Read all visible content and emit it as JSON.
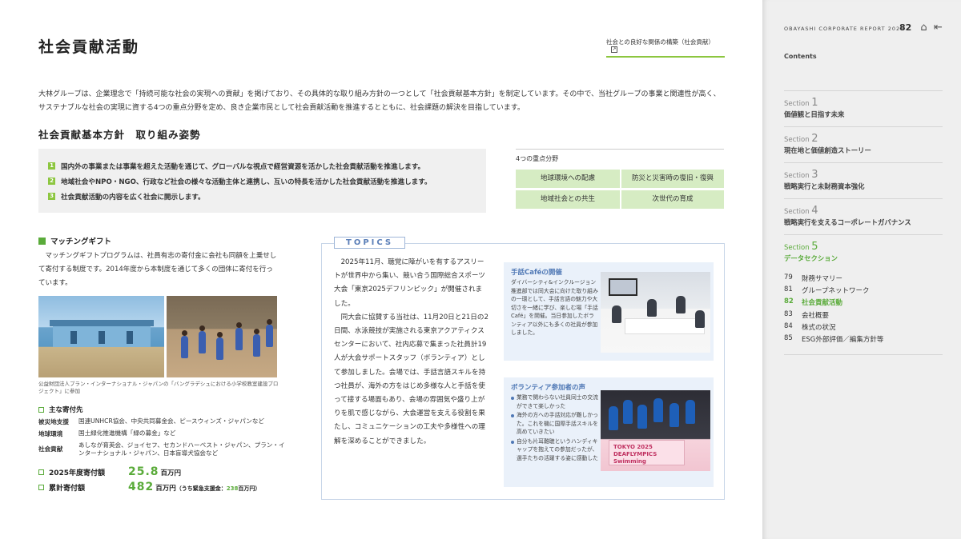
{
  "page": {
    "title": "社会貢献活動",
    "related_link": "社会との良好な関係の構築（社会貢献）",
    "intro": "大林グループは、企業理念で「持続可能な社会の実現への貢献」を掲げており、その具体的な取り組み方針の一つとして「社会貢献基本方針」を制定しています。その中で、当社グループの事業と関連性が高く、サステナブルな社会の実現に資する4つの重点分野を定め、良き企業市民として社会貢献活動を推進するとともに、社会課題の解決を目指しています。"
  },
  "policy": {
    "heading": "社会貢献基本方針　取り組み姿勢",
    "items": [
      {
        "num": "1",
        "text": "国内外の事業または事業を超えた活動を通じて、グローバルな視点で経営資源を活かした社会貢献活動を推進します。"
      },
      {
        "num": "2",
        "text": "地域社会やNPO・NGO、行政など社会の様々な活動主体と連携し、互いの特長を活かした社会貢献活動を推進します。"
      },
      {
        "num": "3",
        "text": "社会貢献活動の内容を広く社会に開示します。"
      }
    ]
  },
  "focus_areas": {
    "label": "4つの重点分野",
    "items": [
      "地球環境への配慮",
      "防災と災害時の復旧・復興",
      "地域社会との共生",
      "次世代の育成"
    ]
  },
  "matching_gift": {
    "heading": "マッチングギフト",
    "text": "マッチングギフトプログラムは、社員有志の寄付金に会社も同額を上乗せして寄付する制度です。2014年度から本制度を通じて多くの団体に寄付を行っています。",
    "photo_caption": "公益財団法人プラン・インターナショナル・ジャパンの「バングラデシュにおける小学校教室建設プロジェクト」に参加",
    "donees_heading": "主な寄付先",
    "donees": [
      {
        "field": "被災地支援",
        "orgs": "国連UNHCR協会、中央共同募金会、ピースウィンズ・ジャパンなど"
      },
      {
        "field": "地球環境",
        "orgs": "国土緑化推進機構「緑の募金」など"
      },
      {
        "field": "社会貢献",
        "orgs": "あしなが育英会、ジョイセフ、セカンドハーベスト・ジャパン、プラン・インターナショナル・ジャパン、日本盲導犬協会など"
      }
    ],
    "amount_fy": {
      "label": "2025年度寄付額",
      "value": "25.8",
      "unit": "百万円"
    },
    "amount_total": {
      "label": "累計寄付額",
      "value": "482",
      "unit": "百万円",
      "sub_prefix": "（うち緊急支援金：",
      "sub_value": "238",
      "sub_suffix": "百万円）"
    }
  },
  "topics": {
    "label": "TOPICS",
    "para1": "2025年11月、聴覚に障がいを有するアスリートが世界中から集い、競い合う国際総合スポーツ大会「東京2025デフリンピック」が開催されました。",
    "para2": "同大会に協賛する当社は、11月20日と21日の2日間、水泳競技が実施される東京アクアティクスセンターにおいて、社内応募で集まった社員計19人が大会サポートスタッフ（ボランティア）として参加しました。会場では、手話言語スキルを持つ社員が、海外の方をはじめ多様な人と手話を使って接する場面もあり、会場の雰囲気や盛り上がりを肌で感じながら、大会運営を支える役割を果たし、コミュニケーションの工夫や多様性への理解を深めることができました。",
    "card1": {
      "title": "手話Caféの開催",
      "body": "ダイバーシティ&インクルージョン推進部では同大会に向けた取り組みの一環として、手話言語の魅力や大切さを一緒に学び、楽しむ場「手話Café」を開催。当日参加したボランティア以外にも多くの社員が参加しました。"
    },
    "card2": {
      "title": "ボランティア参加者の声",
      "voices": [
        "業務で関わらない社員同士の交流ができて楽しかった",
        "海外の方への手話対応が難しかった。これを機に国際手話スキルを高めていきたい",
        "自分も片耳難聴というハンディキャップを抱えての参加だったが、選手たちの活躍する姿に感動した"
      ],
      "banner": "TOKYO 2025 DEAFLYMPICS Swimming"
    }
  },
  "sidebar": {
    "report": "OBAYASHI CORPORATE REPORT 2026",
    "page_number": "82",
    "home_icon": "home-icon",
    "back_icon": "back-to-start-icon",
    "contents_label": "Contents",
    "sections": [
      {
        "prefix": "Section ",
        "num": "1",
        "title": "価値観と目指す未来",
        "active": false
      },
      {
        "prefix": "Section ",
        "num": "2",
        "title": "現在地と価値創造ストーリー",
        "active": false
      },
      {
        "prefix": "Section ",
        "num": "3",
        "title": "戦略実行と未財務資本強化",
        "active": false
      },
      {
        "prefix": "Section ",
        "num": "4",
        "title": "戦略実行を支えるコーポレートガバナンス",
        "active": false
      },
      {
        "prefix": "Section ",
        "num": "5",
        "title": "データセクション",
        "active": true
      }
    ],
    "pages": [
      {
        "page": "79",
        "label": "財務サマリー",
        "active": false
      },
      {
        "page": "81",
        "label": "グループネットワーク",
        "active": false
      },
      {
        "page": "82",
        "label": "社会貢献活動",
        "active": true
      },
      {
        "page": "83",
        "label": "会社概要",
        "active": false
      },
      {
        "page": "84",
        "label": "株式の状況",
        "active": false
      },
      {
        "page": "85",
        "label": "ESG外部評価／編集方針等",
        "active": false
      }
    ],
    "accent_color": "#5aab3a"
  }
}
